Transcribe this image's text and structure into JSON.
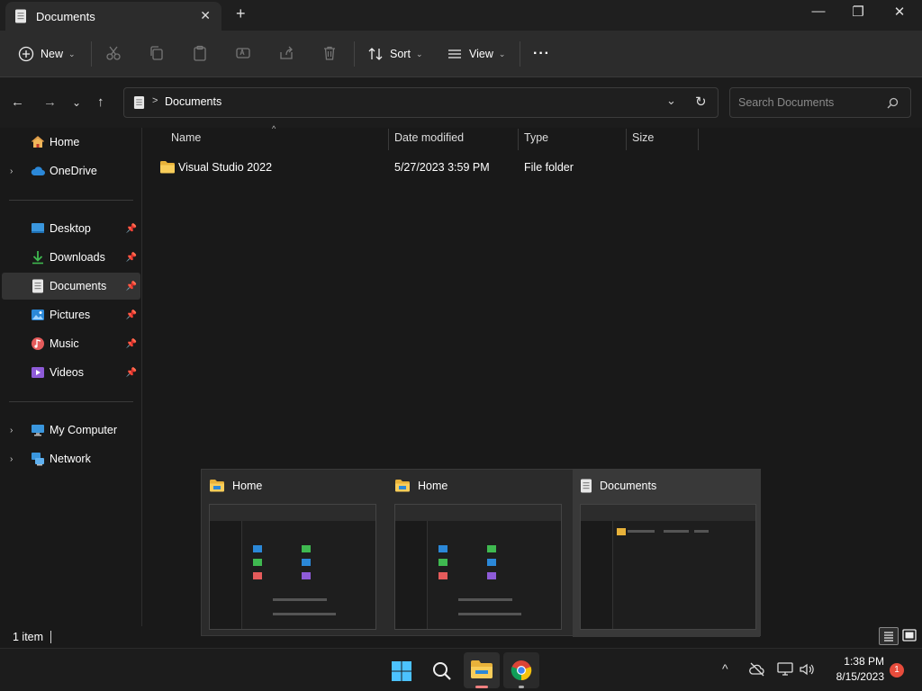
{
  "window": {
    "tab_title": "Documents",
    "tab_close": "✕",
    "new_tab": "+",
    "minimize": "—",
    "maximize": "❐",
    "close": "✕"
  },
  "toolbar": {
    "new_label": "New",
    "sort_label": "Sort",
    "view_label": "View",
    "more_label": "···"
  },
  "nav": {
    "breadcrumb_sep": ">",
    "breadcrumb": "Documents",
    "search_placeholder": "Search Documents"
  },
  "sidebar": {
    "items": [
      {
        "label": "Home"
      },
      {
        "label": "OneDrive"
      },
      {
        "label": "Desktop"
      },
      {
        "label": "Downloads"
      },
      {
        "label": "Documents"
      },
      {
        "label": "Pictures"
      },
      {
        "label": "Music"
      },
      {
        "label": "Videos"
      },
      {
        "label": "My Computer"
      },
      {
        "label": "Network"
      }
    ]
  },
  "columns": {
    "name": "Name",
    "date": "Date modified",
    "type": "Type",
    "size": "Size"
  },
  "files": [
    {
      "name": "Visual Studio 2022",
      "date": "5/27/2023 3:59 PM",
      "type": "File folder",
      "size": ""
    }
  ],
  "status": {
    "count": "1 item"
  },
  "previews": [
    {
      "title": "Home"
    },
    {
      "title": "Home"
    },
    {
      "title": "Documents"
    }
  ],
  "taskbar": {
    "time": "1:38 PM",
    "date": "8/15/2023",
    "notification_count": "1"
  },
  "colors": {
    "accent_blue": "#0078d4",
    "folder_yellow": "#f8c84a",
    "notification_red": "#e74c3c"
  }
}
